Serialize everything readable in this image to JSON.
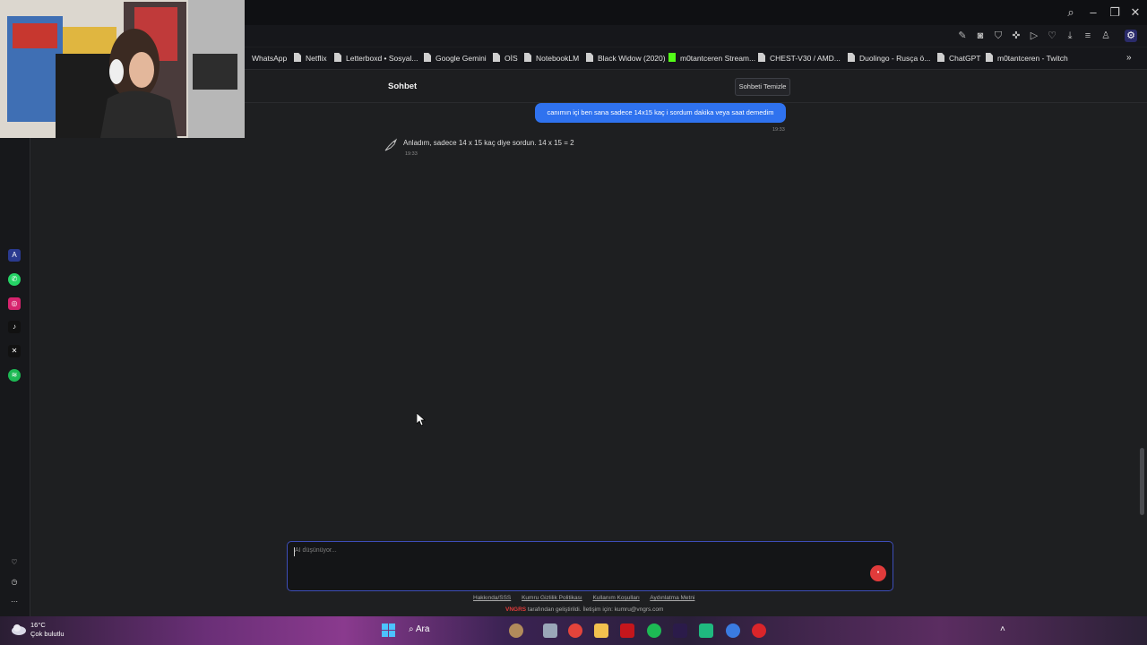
{
  "browser": {
    "bookmarks": [
      "WhatsApp",
      "Netflix",
      "Letterboxd • Sosyal...",
      "Google Gemini",
      "OİS",
      "NotebookLM",
      "Black Widow (2020)",
      "m0tantceren Stream...",
      "CHEST-V30 / AMD...",
      "Duolingo - Rusça ö...",
      "ChatGPT",
      "m0tantceren - Twitch"
    ]
  },
  "page": {
    "title": "Sohbet",
    "clear_button": "Sohbeti Temizle"
  },
  "messages": [
    {
      "role": "user",
      "text": "canımın içi ben sana sadece 14x15 kaç i sordum dakika veya saat demedim",
      "time": "19:33"
    },
    {
      "role": "assistant",
      "text": "Anladım, sadece 14 x 15 kaç diye sordun. 14 x 15 = 2",
      "time": "19:33"
    }
  ],
  "composer": {
    "placeholder": "AI düşünüyor..."
  },
  "footer": {
    "links": [
      "Hakkında/SSS",
      "Kumru Gizlilik Politikası",
      "Kullanım Koşulları",
      "Aydınlatma Metni"
    ],
    "brand": "VNGRS",
    "note": " tarafından geliştirildi. İletişim için: kumru@vngrs.com"
  },
  "taskbar": {
    "temperature": "16°C",
    "condition": "Çok bulutlu",
    "search_label": "Ara"
  },
  "colors": {
    "accent_blue": "#2f72ef",
    "send_red": "#e13b3b",
    "input_border": "#3d4db8"
  }
}
